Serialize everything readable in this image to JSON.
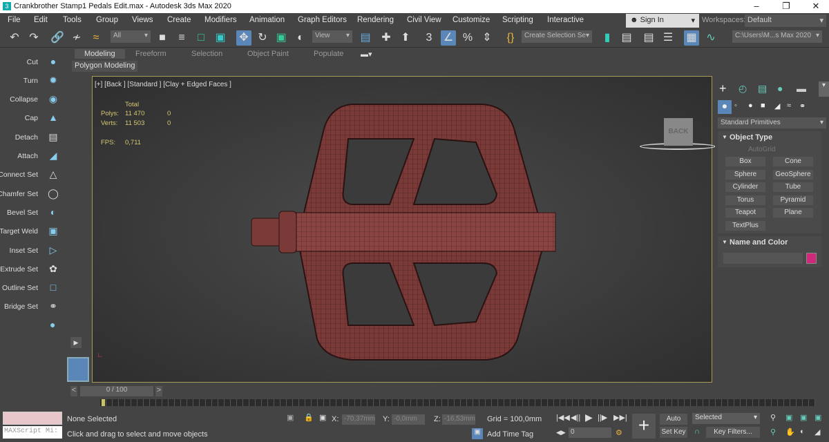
{
  "window": {
    "title": "Crankbrother Stamp1 Pedals Edit.max - Autodesk 3ds Max 2020",
    "app_icon": "3",
    "controls": [
      "minimize-icon",
      "restore-icon",
      "close-icon"
    ]
  },
  "menu": [
    "File",
    "Edit",
    "Tools",
    "Group",
    "Views",
    "Create",
    "Modifiers",
    "Animation",
    "Graph Editors",
    "Rendering",
    "Civil View",
    "Customize",
    "Scripting",
    "Interactive"
  ],
  "signin": {
    "label": "Sign In",
    "workspaces_label": "Workspaces:",
    "workspace": "Default"
  },
  "toolbar": {
    "filter": "All",
    "ref_coord": "View",
    "snap_label": "3",
    "selection_set": "Create Selection Se",
    "project_path": "C:\\Users\\M...s Max 2020"
  },
  "ribbon": {
    "tabs": [
      "Modeling",
      "Freeform",
      "Selection",
      "Object Paint",
      "Populate"
    ],
    "active_tab": "Modeling",
    "panel": "Polygon Modeling"
  },
  "left_panel": [
    "Cut",
    "Turn",
    "Collapse",
    "Cap",
    "Detach",
    "Attach",
    "Connect Set",
    "Chamfer Set",
    "Bevel Set",
    "Target Weld",
    "Inset Set",
    "Extrude Set",
    "Outline Set",
    "Bridge Set"
  ],
  "viewport": {
    "label": "[+] [Back ] [Standard ] [Clay + Edged Faces ]",
    "stats": {
      "header": "Total",
      "polys_label": "Polys:",
      "polys": "11 470",
      "polys_sel": "0",
      "verts_label": "Verts:",
      "verts": "11 503",
      "verts_sel": "0",
      "fps_label": "FPS:",
      "fps": "0,711"
    },
    "viewcube": "BACK",
    "model_color": "#7a3a38"
  },
  "command_panel": {
    "category": "Standard Primitives",
    "object_type_title": "Object Type",
    "autogrid": "AutoGrid",
    "buttons": [
      "Box",
      "Cone",
      "Sphere",
      "GeoSphere",
      "Cylinder",
      "Tube",
      "Torus",
      "Pyramid",
      "Teapot",
      "Plane",
      "TextPlus"
    ],
    "name_color_title": "Name and Color",
    "object_color": "#d0287a"
  },
  "timeline": {
    "frame": "0 / 100"
  },
  "status": {
    "maxscript": "MAXScript Mi:",
    "selection": "None Selected",
    "prompt": "Click and drag to select and move objects",
    "x_label": "X:",
    "x": "-70,37mm",
    "y_label": "Y:",
    "y": "-0,0mm",
    "z_label": "Z:",
    "z": "-16,53mm",
    "grid": "Grid = 100,0mm",
    "add_time_tag": "Add Time Tag",
    "current_frame": "0",
    "auto_key": "Auto Key",
    "set_key": "Set Key",
    "key_mode": "Selected",
    "key_filters": "Key Filters..."
  }
}
